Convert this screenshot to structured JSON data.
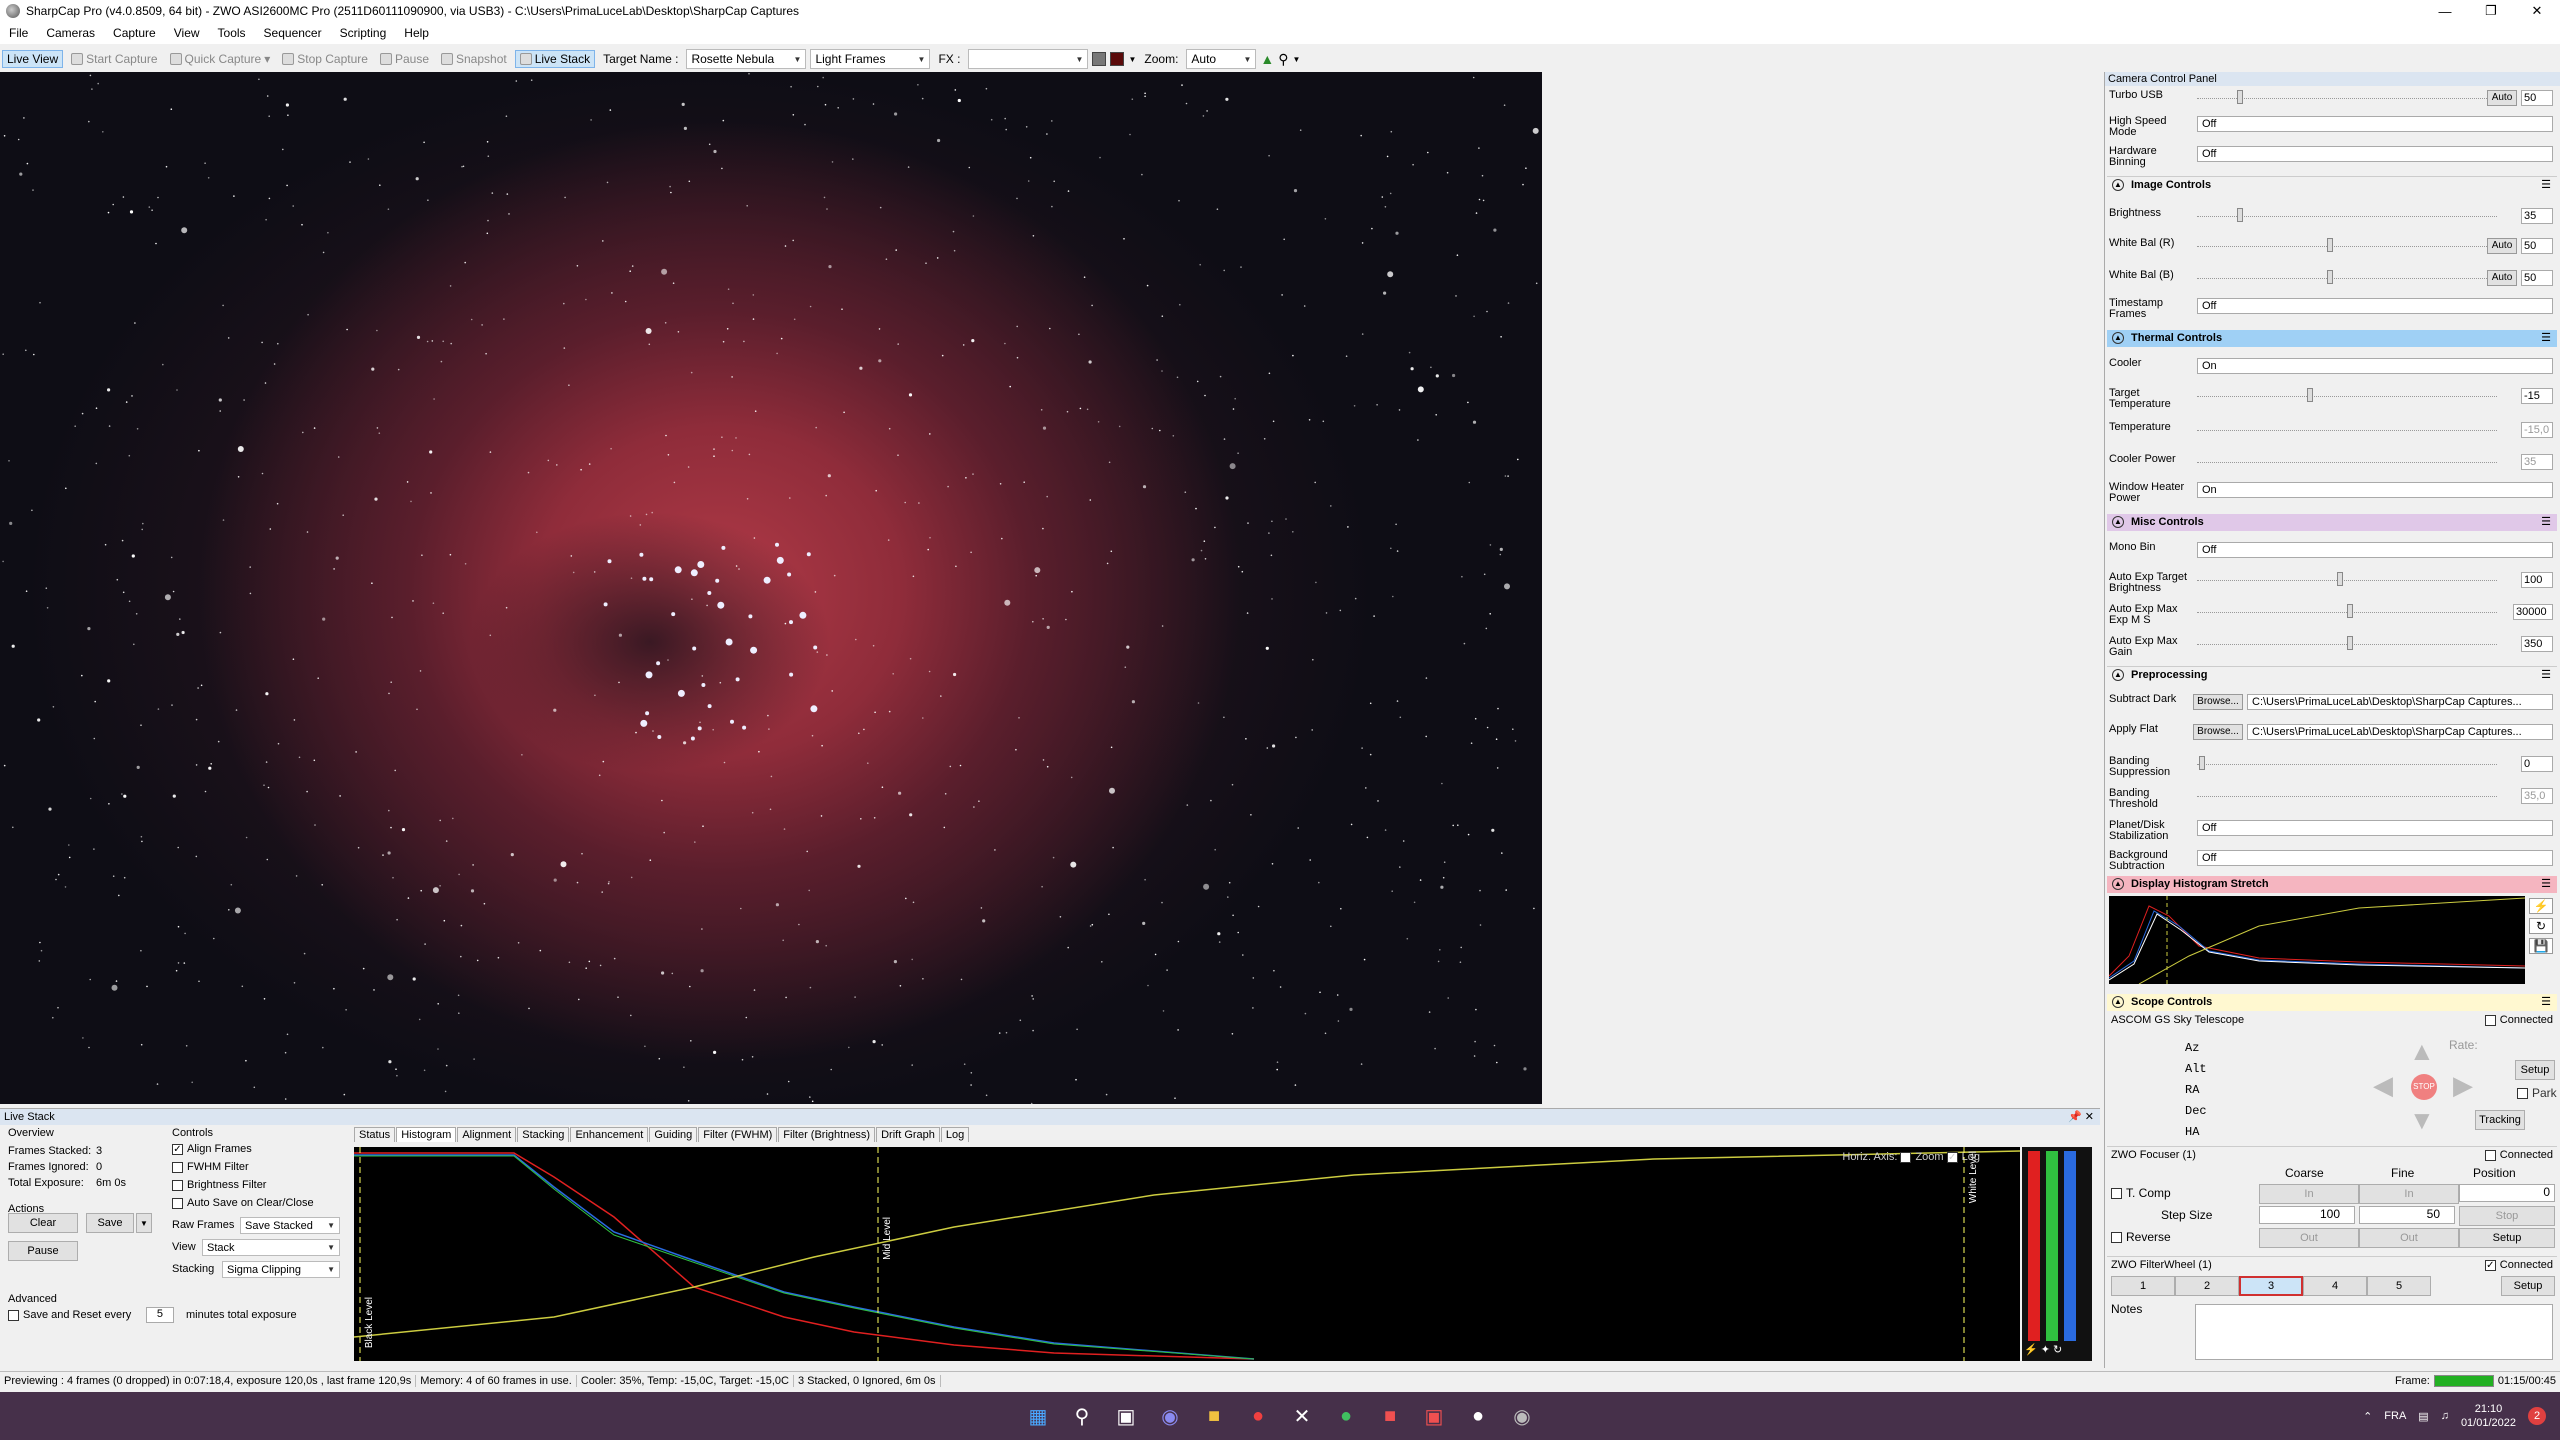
{
  "window": {
    "title": "SharpCap Pro (v4.0.8509, 64 bit) - ZWO ASI2600MC Pro (2511D60111090900, via USB3) - C:\\Users\\PrimaLuceLab\\Desktop\\SharpCap Captures"
  },
  "menu": [
    "File",
    "Cameras",
    "Capture",
    "View",
    "Tools",
    "Sequencer",
    "Scripting",
    "Help"
  ],
  "toolbar": {
    "live_view": "Live View",
    "start_capture": "Start Capture",
    "quick_capture": "Quick Capture",
    "stop_capture": "Stop Capture",
    "pause": "Pause",
    "snapshot": "Snapshot",
    "live_stack": "Live Stack",
    "target_label": "Target Name :",
    "target_value": "Rosette Nebula",
    "frame_type": "Light Frames",
    "fx_label": "FX :",
    "zoom_label": "Zoom:",
    "zoom_value": "Auto"
  },
  "livestack": {
    "title": "Live Stack",
    "overview_label": "Overview",
    "frames_stacked_label": "Frames Stacked:",
    "frames_stacked": "3",
    "frames_ignored_label": "Frames Ignored:",
    "frames_ignored": "0",
    "total_exposure_label": "Total Exposure:",
    "total_exposure": "6m 0s",
    "actions_label": "Actions",
    "clear": "Clear",
    "save": "Save",
    "pause": "Pause",
    "advanced_label": "Advanced",
    "save_reset": "Save and Reset every",
    "minutes_value": "5",
    "minutes_label": "minutes total exposure",
    "controls_label": "Controls",
    "align_frames": "Align Frames",
    "fwhm_filter": "FWHM Filter",
    "brightness_filter": "Brightness Filter",
    "auto_save": "Auto Save on Clear/Close",
    "raw_frames_label": "Raw Frames",
    "raw_frames_value": "Save Stacked",
    "view_label": "View",
    "view_value": "Stack",
    "stacking_label": "Stacking",
    "stacking_value": "Sigma Clipping",
    "tabs": [
      "Status",
      "Histogram",
      "Alignment",
      "Stacking",
      "Enhancement",
      "Guiding",
      "Filter (FWHM)",
      "Filter (Brightness)",
      "Drift Graph",
      "Log"
    ],
    "histo_horiz": "Horiz. Axis:",
    "histo_zoom": "Zoom",
    "histo_log": "Log",
    "black_level": "Black Level",
    "mid_level": "Mid Level",
    "white_level": "White Level"
  },
  "status": {
    "preview": "Previewing : 4 frames (0 dropped) in 0:07:18,4, exposure 120,0s , last frame 120,9s",
    "memory": "Memory: 4 of 60 frames in use.",
    "cooler": "Cooler: 35%, Temp: -15,0C, Target: -15,0C",
    "stacked": "3 Stacked, 0 Ignored, 6m 0s",
    "frame_label": "Frame:",
    "time": "01:15/00:45"
  },
  "panel": {
    "title": "Camera Control Panel",
    "turbo": {
      "label": "Turbo USB",
      "auto": "Auto",
      "value": "50"
    },
    "high_speed": {
      "label": "High Speed Mode",
      "value": "Off"
    },
    "hw_bin": {
      "label": "Hardware Binning",
      "value": "Off"
    },
    "image_controls": "Image Controls",
    "brightness": {
      "label": "Brightness",
      "value": "35"
    },
    "wb_r": {
      "label": "White Bal (R)",
      "auto": "Auto",
      "value": "50"
    },
    "wb_b": {
      "label": "White Bal (B)",
      "auto": "Auto",
      "value": "50"
    },
    "timestamp": {
      "label": "Timestamp Frames",
      "value": "Off"
    },
    "thermal": "Thermal Controls",
    "cooler": {
      "label": "Cooler",
      "value": "On"
    },
    "target_temp": {
      "label": "Target Temperature",
      "value": "-15"
    },
    "temperature": {
      "label": "Temperature",
      "value": "-15,0"
    },
    "cooler_power": {
      "label": "Cooler Power",
      "value": "35"
    },
    "heater": {
      "label": "Window Heater Power",
      "value": "On"
    },
    "misc": "Misc Controls",
    "mono_bin": {
      "label": "Mono Bin",
      "value": "Off"
    },
    "ae_target": {
      "label": "Auto Exp Target Brightness",
      "value": "100"
    },
    "ae_max_exp": {
      "label": "Auto Exp Max Exp M S",
      "value": "30000"
    },
    "ae_max_gain": {
      "label": "Auto Exp Max Gain",
      "value": "350"
    },
    "preproc": "Preprocessing",
    "sub_dark": {
      "label": "Subtract Dark",
      "browse": "Browse...",
      "value": "C:\\Users\\PrimaLuceLab\\Desktop\\SharpCap Captures..."
    },
    "apply_flat": {
      "label": "Apply Flat",
      "browse": "Browse...",
      "value": "C:\\Users\\PrimaLuceLab\\Desktop\\SharpCap Captures..."
    },
    "band_supp": {
      "label": "Banding Suppression",
      "value": "0"
    },
    "band_thr": {
      "label": "Banding Threshold",
      "value": "35,0"
    },
    "planet_stab": {
      "label": "Planet/Disk Stabilization",
      "value": "Off"
    },
    "bg_sub": {
      "label": "Background Subtraction",
      "value": "Off"
    },
    "dhs": "Display Histogram Stretch",
    "scope": "Scope Controls",
    "ascom": "ASCOM GS Sky Telescope",
    "connected": "Connected",
    "rate": "Rate:",
    "setup": "Setup",
    "park": "Park",
    "tracking": "Tracking",
    "stop": "STOP",
    "axes": [
      "Az",
      "Alt",
      "RA",
      "Dec",
      "HA"
    ],
    "focuser": "ZWO Focuser (1)",
    "coarse": "Coarse",
    "fine": "Fine",
    "position": "Position",
    "tcomp": "T. Comp",
    "in": "In",
    "step_size": "Step Size",
    "step_coarse": "100",
    "step_fine": "50",
    "reverse": "Reverse",
    "out": "Out",
    "pos_value": "0",
    "fstop": "Stop",
    "filterwheel": "ZWO FilterWheel (1)",
    "filters": [
      "1",
      "2",
      "3",
      "4",
      "5"
    ],
    "notes": "Notes"
  },
  "taskbar": {
    "lang": "FRA",
    "time": "21:10",
    "date": "01/01/2022"
  },
  "colors": {
    "accent": "#7eb4ea",
    "thermal": "#9fd0f5",
    "misc": "#e0c8e8",
    "dhs": "#f5b5c0",
    "scope": "#fff8d0"
  }
}
